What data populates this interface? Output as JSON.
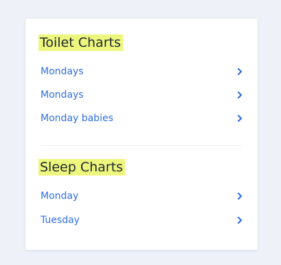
{
  "toilet_charts": {
    "title": "Toilet Charts",
    "items": [
      {
        "label": "Mondays"
      },
      {
        "label": "Mondays"
      },
      {
        "label": "Monday babies"
      }
    ]
  },
  "sleep_charts": {
    "title": "Sleep Charts",
    "items": [
      {
        "label": "Monday"
      },
      {
        "label": "Tuesday"
      }
    ]
  },
  "colors": {
    "highlight": "#eef77d",
    "link": "#2f6fe0",
    "heading": "#1f2633",
    "page_background": "#eef2f8",
    "card_background": "#ffffff"
  },
  "icons": {
    "item_chevron": "chevron-right-icon"
  }
}
